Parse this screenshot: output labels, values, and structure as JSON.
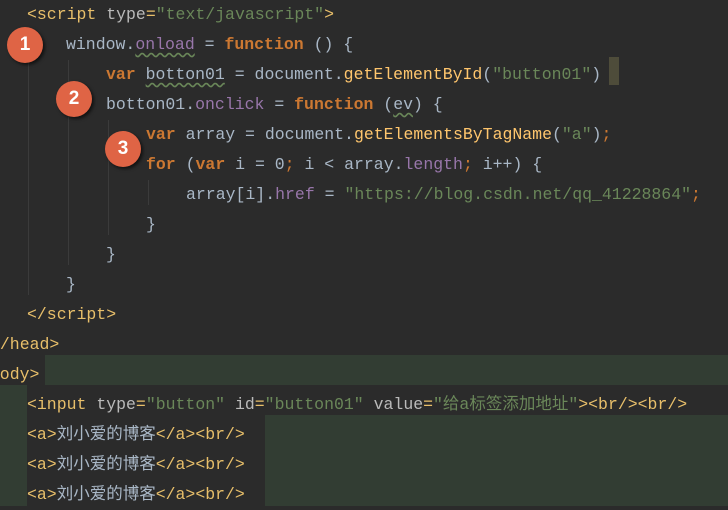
{
  "editor": {
    "lines": [
      [
        [
          "<script ",
          "tag"
        ],
        [
          "type",
          "attr"
        ],
        [
          "=",
          "tag"
        ],
        [
          "\"text/javascript\"",
          "str"
        ],
        [
          ">",
          "tag"
        ]
      ],
      [
        [
          "window.",
          "txt"
        ],
        [
          "onload",
          "prop sq"
        ],
        [
          " = ",
          "txt"
        ],
        [
          "function",
          "kw"
        ],
        [
          " () {",
          "txt"
        ]
      ],
      [
        [
          "var",
          "kw"
        ],
        [
          " ",
          "txt"
        ],
        [
          "botton01",
          "txt sq"
        ],
        [
          " = document.",
          "txt"
        ],
        [
          "getElementById",
          "fn"
        ],
        [
          "(",
          "txt"
        ],
        [
          "\"button01\"",
          "str"
        ],
        [
          ")",
          "txt"
        ]
      ],
      [
        [
          "botton01.",
          "txt"
        ],
        [
          "onclick",
          "prop"
        ],
        [
          " = ",
          "txt"
        ],
        [
          "function",
          "kw"
        ],
        [
          " (",
          "txt"
        ],
        [
          "ev",
          "txt sq"
        ],
        [
          ") {",
          "txt"
        ]
      ],
      [
        [
          "var",
          "kw"
        ],
        [
          " array = document.",
          "txt"
        ],
        [
          "getElementsByTagName",
          "fn"
        ],
        [
          "(",
          "txt"
        ],
        [
          "\"a\"",
          "str"
        ],
        [
          ")",
          "txt"
        ],
        [
          ";",
          "semi"
        ]
      ],
      [
        [
          "for",
          "kw"
        ],
        [
          " (",
          "txt"
        ],
        [
          "var",
          "kw"
        ],
        [
          " i = ",
          "txt"
        ],
        [
          "0",
          "txt"
        ],
        [
          "; ",
          "semi"
        ],
        [
          "i < array.",
          "txt"
        ],
        [
          "length",
          "prop"
        ],
        [
          "; ",
          "semi"
        ],
        [
          "i++) {",
          "txt"
        ]
      ],
      [
        [
          "array[i].",
          "txt"
        ],
        [
          "href",
          "prop"
        ],
        [
          " = ",
          "txt"
        ],
        [
          "\"https://blog.csdn.net/qq_41228864\"",
          "str"
        ],
        [
          ";",
          "semi"
        ]
      ],
      [
        [
          "}",
          "txt"
        ]
      ],
      [
        [
          "}",
          "txt"
        ]
      ],
      [
        [
          "}",
          "txt"
        ]
      ],
      [
        [
          "</script>",
          "tag"
        ]
      ],
      [
        [
          "</head>",
          "tag"
        ]
      ],
      [
        [
          "<body>",
          "tag"
        ]
      ],
      [
        [
          "<input ",
          "tag"
        ],
        [
          "type",
          "attr"
        ],
        [
          "=",
          "tag"
        ],
        [
          "\"button\"",
          "str"
        ],
        [
          " ",
          "tag"
        ],
        [
          "id",
          "attr"
        ],
        [
          "=",
          "tag"
        ],
        [
          "\"button01\"",
          "str"
        ],
        [
          " ",
          "tag"
        ],
        [
          "value",
          "attr"
        ],
        [
          "=",
          "tag"
        ],
        [
          "\"给a标签添加地址\"",
          "str"
        ],
        [
          "><br/><br/>",
          "tag"
        ]
      ],
      [
        [
          "<a>",
          "tag"
        ],
        [
          "刘小爱的博客",
          "txt"
        ],
        [
          "</a><br/>",
          "tag"
        ]
      ],
      [
        [
          "<a>",
          "tag"
        ],
        [
          "刘小爱的博客",
          "txt"
        ],
        [
          "</a><br/>",
          "tag"
        ]
      ],
      [
        [
          "<a>",
          "tag"
        ],
        [
          "刘小爱的博客",
          "txt"
        ],
        [
          "</a><br/>",
          "tag"
        ]
      ]
    ]
  },
  "annotations": [
    "1",
    "2",
    "3"
  ]
}
